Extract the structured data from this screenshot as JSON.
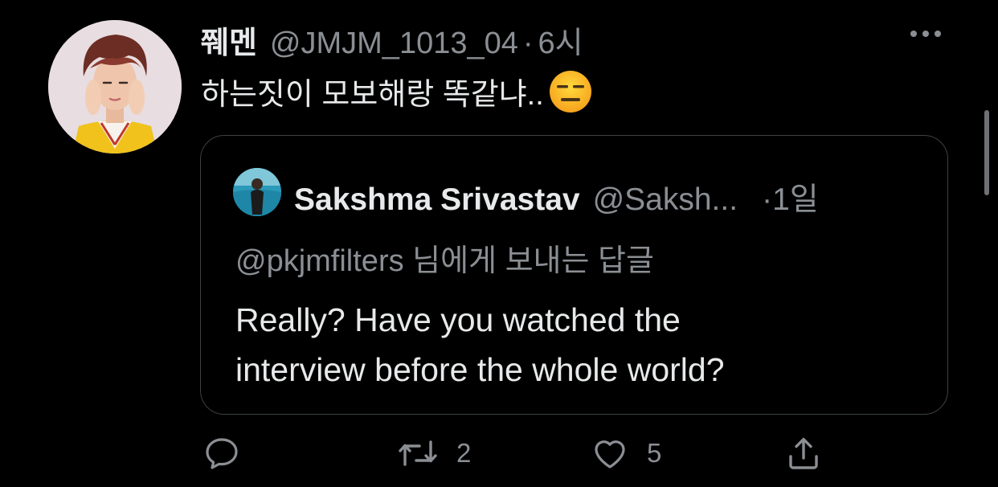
{
  "tweet": {
    "display_name": "쮀멘",
    "handle": "@JMJM_1013_04",
    "separator": "·",
    "time": "6시",
    "text": "하는짓이 모보해랑 똑같냐..",
    "emoji": "expressionless-face",
    "more_icon": "more-icon"
  },
  "quoted_tweet": {
    "display_name": "Sakshma Srivastav",
    "handle": "@Saksh...",
    "time": "·1일",
    "reply_context": "@pkjmfilters 님에게 보내는 답글",
    "body_lines": [
      "Really? Have you watched the",
      "interview before the whole world?"
    ]
  },
  "actions": {
    "reply_icon": "reply-icon",
    "retweet_icon": "retweet-icon",
    "retweet_count": "2",
    "like_icon": "heart-icon",
    "like_count": "5",
    "share_icon": "share-icon"
  },
  "colors": {
    "background": "#000000",
    "primary_text": "#e7e9ea",
    "secondary_text": "#8b8f94",
    "border": "#3d4144"
  }
}
